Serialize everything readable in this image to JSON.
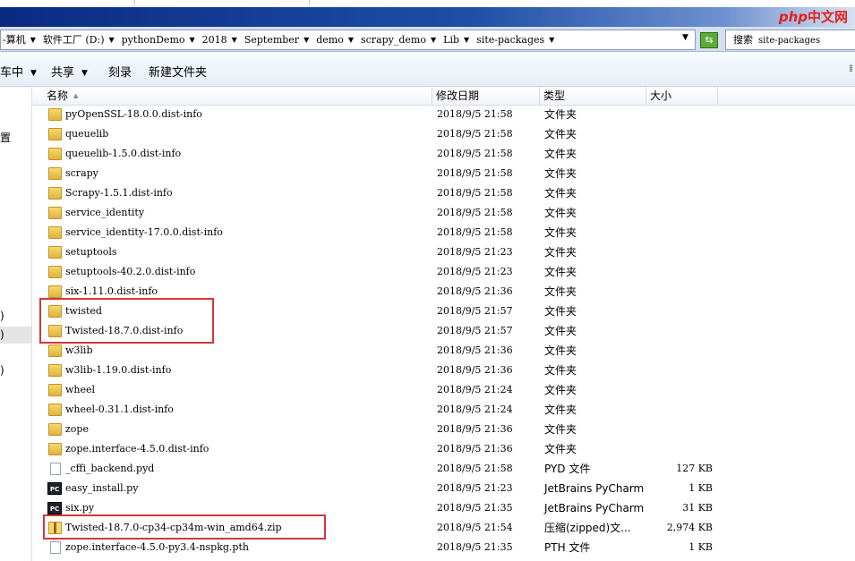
{
  "window": {
    "watermark_php": "php",
    "watermark_cn": "中文网"
  },
  "address": {
    "crumbs": [
      "-算机",
      "软件工厂 (D:)",
      "pythonDemo",
      "2018",
      "September",
      "demo",
      "scrapy_demo",
      "Lib",
      "site-packages"
    ],
    "search_label": "搜索",
    "search_target": "site-packages"
  },
  "toolbar": {
    "organize_label": "车中",
    "share_label": "共享",
    "burn_label": "刻录",
    "new_folder_label": "新建文件夹"
  },
  "sidebar": {
    "fragment_1": "置",
    "fragment_2": ")",
    "fragment_3": ")",
    "fragment_4": ")"
  },
  "columns": {
    "name": "名称",
    "date": "修改日期",
    "type": "类型",
    "size": "大小"
  },
  "files": [
    {
      "name": "pyOpenSSL-18.0.0.dist-info",
      "date": "2018/9/5 21:58",
      "type": "文件夹",
      "size": "",
      "icon": "folder-icon"
    },
    {
      "name": "queuelib",
      "date": "2018/9/5 21:58",
      "type": "文件夹",
      "size": "",
      "icon": "folder-icon"
    },
    {
      "name": "queuelib-1.5.0.dist-info",
      "date": "2018/9/5 21:58",
      "type": "文件夹",
      "size": "",
      "icon": "folder-icon"
    },
    {
      "name": "scrapy",
      "date": "2018/9/5 21:58",
      "type": "文件夹",
      "size": "",
      "icon": "folder-icon"
    },
    {
      "name": "Scrapy-1.5.1.dist-info",
      "date": "2018/9/5 21:58",
      "type": "文件夹",
      "size": "",
      "icon": "folder-icon"
    },
    {
      "name": "service_identity",
      "date": "2018/9/5 21:58",
      "type": "文件夹",
      "size": "",
      "icon": "folder-icon"
    },
    {
      "name": "service_identity-17.0.0.dist-info",
      "date": "2018/9/5 21:58",
      "type": "文件夹",
      "size": "",
      "icon": "folder-icon"
    },
    {
      "name": "setuptools",
      "date": "2018/9/5 21:23",
      "type": "文件夹",
      "size": "",
      "icon": "folder-icon"
    },
    {
      "name": "setuptools-40.2.0.dist-info",
      "date": "2018/9/5 21:23",
      "type": "文件夹",
      "size": "",
      "icon": "folder-icon"
    },
    {
      "name": "six-1.11.0.dist-info",
      "date": "2018/9/5 21:36",
      "type": "文件夹",
      "size": "",
      "icon": "folder-icon"
    },
    {
      "name": "twisted",
      "date": "2018/9/5 21:57",
      "type": "文件夹",
      "size": "",
      "icon": "folder-icon"
    },
    {
      "name": "Twisted-18.7.0.dist-info",
      "date": "2018/9/5 21:57",
      "type": "文件夹",
      "size": "",
      "icon": "folder-icon"
    },
    {
      "name": "w3lib",
      "date": "2018/9/5 21:36",
      "type": "文件夹",
      "size": "",
      "icon": "folder-icon"
    },
    {
      "name": "w3lib-1.19.0.dist-info",
      "date": "2018/9/5 21:36",
      "type": "文件夹",
      "size": "",
      "icon": "folder-icon"
    },
    {
      "name": "wheel",
      "date": "2018/9/5 21:24",
      "type": "文件夹",
      "size": "",
      "icon": "folder-icon"
    },
    {
      "name": "wheel-0.31.1.dist-info",
      "date": "2018/9/5 21:24",
      "type": "文件夹",
      "size": "",
      "icon": "folder-icon"
    },
    {
      "name": "zope",
      "date": "2018/9/5 21:36",
      "type": "文件夹",
      "size": "",
      "icon": "folder-icon"
    },
    {
      "name": "zope.interface-4.5.0.dist-info",
      "date": "2018/9/5 21:36",
      "type": "文件夹",
      "size": "",
      "icon": "folder-icon"
    },
    {
      "name": "_cffi_backend.pyd",
      "date": "2018/9/5 21:58",
      "type": "PYD 文件",
      "size": "127 KB",
      "icon": "file-icon"
    },
    {
      "name": "easy_install.py",
      "date": "2018/9/5 21:23",
      "type": "JetBrains PyCharm",
      "size": "1 KB",
      "icon": "pycharm-icon"
    },
    {
      "name": "six.py",
      "date": "2018/9/5 21:35",
      "type": "JetBrains PyCharm",
      "size": "31 KB",
      "icon": "pycharm-icon"
    },
    {
      "name": "Twisted-18.7.0-cp34-cp34m-win_amd64.zip",
      "date": "2018/9/5 21:54",
      "type": "压缩(zipped)文...",
      "size": "2,974 KB",
      "icon": "zip-icon"
    },
    {
      "name": "zope.interface-4.5.0-py3.4-nspkg.pth",
      "date": "2018/9/5 21:35",
      "type": "PTH 文件",
      "size": "1 KB",
      "icon": "file-icon"
    }
  ],
  "colors": {
    "highlight": "#d0393b",
    "folder": "#f0c850",
    "titlebar": "#1e4ea6"
  }
}
